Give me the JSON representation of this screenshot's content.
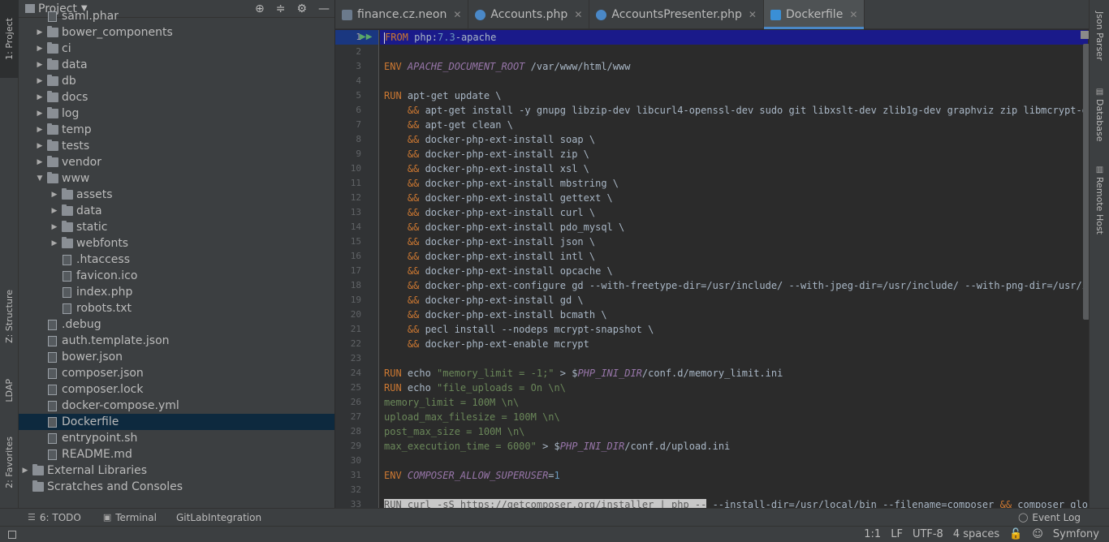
{
  "left_strip": {
    "project": "1: Project",
    "structure": "Z: Structure",
    "ldap": "LDAP",
    "favorites": "2: Favorites"
  },
  "project_panel": {
    "title": "Project",
    "tree": [
      {
        "label": "saml.phar",
        "type": "file",
        "indent": 1,
        "arrow": ""
      },
      {
        "label": "bower_components",
        "type": "folder",
        "indent": 1,
        "arrow": "▶"
      },
      {
        "label": "ci",
        "type": "folder",
        "indent": 1,
        "arrow": "▶"
      },
      {
        "label": "data",
        "type": "folder",
        "indent": 1,
        "arrow": "▶"
      },
      {
        "label": "db",
        "type": "folder",
        "indent": 1,
        "arrow": "▶"
      },
      {
        "label": "docs",
        "type": "folder",
        "indent": 1,
        "arrow": "▶"
      },
      {
        "label": "log",
        "type": "folder",
        "indent": 1,
        "arrow": "▶"
      },
      {
        "label": "temp",
        "type": "folder",
        "indent": 1,
        "arrow": "▶"
      },
      {
        "label": "tests",
        "type": "folder",
        "indent": 1,
        "arrow": "▶"
      },
      {
        "label": "vendor",
        "type": "folder",
        "indent": 1,
        "arrow": "▶"
      },
      {
        "label": "www",
        "type": "folder",
        "indent": 1,
        "arrow": "▼"
      },
      {
        "label": "assets",
        "type": "folder",
        "indent": 2,
        "arrow": "▶"
      },
      {
        "label": "data",
        "type": "folder",
        "indent": 2,
        "arrow": "▶"
      },
      {
        "label": "static",
        "type": "folder",
        "indent": 2,
        "arrow": "▶"
      },
      {
        "label": "webfonts",
        "type": "folder",
        "indent": 2,
        "arrow": "▶"
      },
      {
        "label": ".htaccess",
        "type": "file",
        "indent": 2,
        "arrow": ""
      },
      {
        "label": "favicon.ico",
        "type": "file",
        "indent": 2,
        "arrow": ""
      },
      {
        "label": "index.php",
        "type": "file",
        "indent": 2,
        "arrow": ""
      },
      {
        "label": "robots.txt",
        "type": "file",
        "indent": 2,
        "arrow": ""
      },
      {
        "label": ".debug",
        "type": "file",
        "indent": 1,
        "arrow": ""
      },
      {
        "label": "auth.template.json",
        "type": "file",
        "indent": 1,
        "arrow": ""
      },
      {
        "label": "bower.json",
        "type": "file",
        "indent": 1,
        "arrow": ""
      },
      {
        "label": "composer.json",
        "type": "file",
        "indent": 1,
        "arrow": ""
      },
      {
        "label": "composer.lock",
        "type": "file",
        "indent": 1,
        "arrow": ""
      },
      {
        "label": "docker-compose.yml",
        "type": "file",
        "indent": 1,
        "arrow": ""
      },
      {
        "label": "Dockerfile",
        "type": "file",
        "indent": 1,
        "arrow": "",
        "selected": true
      },
      {
        "label": "entrypoint.sh",
        "type": "file",
        "indent": 1,
        "arrow": ""
      },
      {
        "label": "README.md",
        "type": "file",
        "indent": 1,
        "arrow": ""
      },
      {
        "label": "External Libraries",
        "type": "lib",
        "indent": 0,
        "arrow": "▶"
      },
      {
        "label": "Scratches and Consoles",
        "type": "lib",
        "indent": 0,
        "arrow": ""
      }
    ]
  },
  "tabs": [
    {
      "label": "finance.cz.neon",
      "icon": "neon",
      "active": false
    },
    {
      "label": "Accounts.php",
      "icon": "php",
      "active": false
    },
    {
      "label": "AccountsPresenter.php",
      "icon": "php",
      "active": false
    },
    {
      "label": "Dockerfile",
      "icon": "docker",
      "active": true
    }
  ],
  "editor": {
    "lines": [
      [
        [
          "kw",
          "FROM "
        ],
        [
          "t",
          "php:"
        ],
        [
          "num",
          "7.3"
        ],
        [
          "t",
          "-apache"
        ]
      ],
      [],
      [
        [
          "kw",
          "ENV "
        ],
        [
          "var",
          "APACHE_DOCUMENT_ROOT "
        ],
        [
          "t",
          "/var/www/html/www"
        ]
      ],
      [],
      [
        [
          "kw",
          "RUN "
        ],
        [
          "t",
          "apt-get update \\"
        ]
      ],
      [
        [
          "t",
          "    "
        ],
        [
          "amp",
          "&&"
        ],
        [
          "t",
          " apt-get install -y gnupg libzip-dev libcurl4-openssl-dev sudo git libxslt-dev zlib1g-dev graphviz zip libmcrypt-dev l"
        ]
      ],
      [
        [
          "t",
          "    "
        ],
        [
          "amp",
          "&&"
        ],
        [
          "t",
          " apt-get clean \\"
        ]
      ],
      [
        [
          "t",
          "    "
        ],
        [
          "amp",
          "&&"
        ],
        [
          "t",
          " docker-php-ext-install soap \\"
        ]
      ],
      [
        [
          "t",
          "    "
        ],
        [
          "amp",
          "&&"
        ],
        [
          "t",
          " docker-php-ext-install zip \\"
        ]
      ],
      [
        [
          "t",
          "    "
        ],
        [
          "amp",
          "&&"
        ],
        [
          "t",
          " docker-php-ext-install xsl \\"
        ]
      ],
      [
        [
          "t",
          "    "
        ],
        [
          "amp",
          "&&"
        ],
        [
          "t",
          " docker-php-ext-install mbstring \\"
        ]
      ],
      [
        [
          "t",
          "    "
        ],
        [
          "amp",
          "&&"
        ],
        [
          "t",
          " docker-php-ext-install gettext \\"
        ]
      ],
      [
        [
          "t",
          "    "
        ],
        [
          "amp",
          "&&"
        ],
        [
          "t",
          " docker-php-ext-install curl \\"
        ]
      ],
      [
        [
          "t",
          "    "
        ],
        [
          "amp",
          "&&"
        ],
        [
          "t",
          " docker-php-ext-install pdo_mysql \\"
        ]
      ],
      [
        [
          "t",
          "    "
        ],
        [
          "amp",
          "&&"
        ],
        [
          "t",
          " docker-php-ext-install json \\"
        ]
      ],
      [
        [
          "t",
          "    "
        ],
        [
          "amp",
          "&&"
        ],
        [
          "t",
          " docker-php-ext-install intl \\"
        ]
      ],
      [
        [
          "t",
          "    "
        ],
        [
          "amp",
          "&&"
        ],
        [
          "t",
          " docker-php-ext-install opcache \\"
        ]
      ],
      [
        [
          "t",
          "    "
        ],
        [
          "amp",
          "&&"
        ],
        [
          "t",
          " docker-php-ext-configure gd --with-freetype-dir=/usr/include/ --with-jpeg-dir=/usr/include/ --with-png-dir=/usr/inclu"
        ]
      ],
      [
        [
          "t",
          "    "
        ],
        [
          "amp",
          "&&"
        ],
        [
          "t",
          " docker-php-ext-install gd \\"
        ]
      ],
      [
        [
          "t",
          "    "
        ],
        [
          "amp",
          "&&"
        ],
        [
          "t",
          " docker-php-ext-install bcmath \\"
        ]
      ],
      [
        [
          "t",
          "    "
        ],
        [
          "amp",
          "&&"
        ],
        [
          "t",
          " pecl install --nodeps mcrypt-snapshot \\"
        ]
      ],
      [
        [
          "t",
          "    "
        ],
        [
          "amp",
          "&&"
        ],
        [
          "t",
          " docker-php-ext-enable mcrypt"
        ]
      ],
      [],
      [
        [
          "kw",
          "RUN "
        ],
        [
          "t",
          "echo "
        ],
        [
          "str",
          "\"memory_limit = -1;\""
        ],
        [
          "t",
          " > $"
        ],
        [
          "var",
          "PHP_INI_DIR"
        ],
        [
          "t",
          "/conf.d/memory_limit.ini"
        ]
      ],
      [
        [
          "kw",
          "RUN "
        ],
        [
          "t",
          "echo "
        ],
        [
          "str",
          "\"file_uploads = On \\n\\"
        ]
      ],
      [
        [
          "str",
          "memory_limit = 100M \\n\\"
        ]
      ],
      [
        [
          "str",
          "upload_max_filesize = 100M \\n\\"
        ]
      ],
      [
        [
          "str",
          "post_max_size = 100M \\n\\"
        ]
      ],
      [
        [
          "str",
          "max_execution_time = 6000\""
        ],
        [
          "t",
          " > $"
        ],
        [
          "var",
          "PHP_INI_DIR"
        ],
        [
          "t",
          "/conf.d/upload.ini"
        ]
      ],
      [],
      [
        [
          "kw",
          "ENV "
        ],
        [
          "var",
          "COMPOSER_ALLOW_SUPERUSER"
        ],
        [
          "t",
          "="
        ],
        [
          "num",
          "1"
        ]
      ],
      [],
      [
        [
          "hl",
          "RUN curl -sS https://getcomposer.org/installer | php --"
        ],
        [
          "t",
          " --install-dir=/usr/local/bin --filename=composer "
        ],
        [
          "amp",
          "&&"
        ],
        [
          "t",
          " composer global"
        ]
      ]
    ]
  },
  "right_strip": {
    "json_parser": "Json Parser",
    "database": "Database",
    "remote_host": "Remote Host"
  },
  "bottom_tools": {
    "todo": "6: TODO",
    "terminal": "Terminal",
    "gitlab": "GitLabIntegration",
    "event_log": "Event Log"
  },
  "status": {
    "position": "1:1",
    "line_sep": "LF",
    "encoding": "UTF-8",
    "indent": "4 spaces",
    "framework": "Symfony"
  }
}
